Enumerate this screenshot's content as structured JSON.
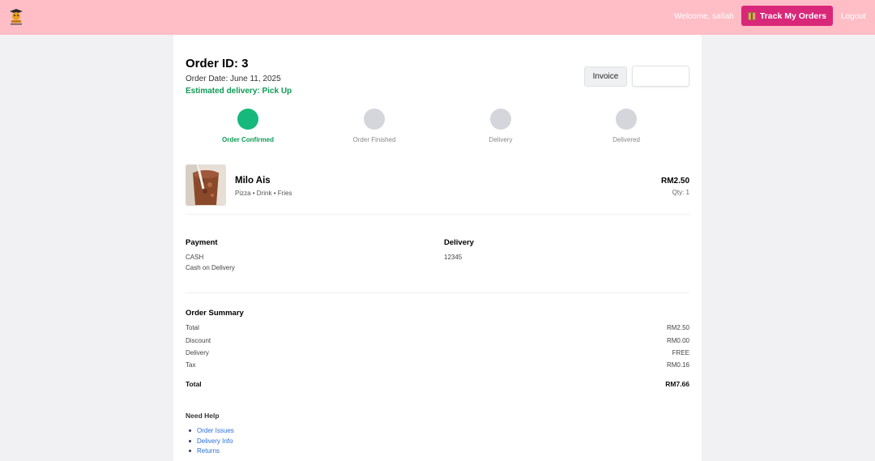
{
  "header": {
    "welcome": "Welcome, safiah",
    "track_label": "Track My Orders",
    "logout_label": "Logout",
    "brand_color": "#ffbdc6",
    "button_color": "#d9277a",
    "track_icon": "box-icon"
  },
  "order": {
    "title": "Order ID: 3",
    "date": "Order Date: June 11, 2025",
    "estimated": "Estimated delivery: Pick Up",
    "invoice_label": "Invoice"
  },
  "progress": {
    "steps": [
      {
        "label": "Order Confirmed",
        "active": true
      },
      {
        "label": "Order Finished",
        "active": false
      },
      {
        "label": "Delivery",
        "active": false
      },
      {
        "label": "Delivered",
        "active": false
      }
    ],
    "active_color": "#17b97a",
    "inactive_color": "#d4d6db"
  },
  "item": {
    "name": "Milo Ais",
    "tags": "Pizza • Drink • Fries",
    "price": "RM2.50",
    "qty": "Qty: 1"
  },
  "payment": {
    "heading": "Payment",
    "method": "CASH",
    "detail": "Cash on Delivery"
  },
  "delivery": {
    "heading": "Delivery",
    "value": "12345"
  },
  "summary": {
    "heading": "Order Summary",
    "rows": [
      {
        "label": "Total",
        "value": "RM2.50"
      },
      {
        "label": "Discount",
        "value": "RM0.00"
      },
      {
        "label": "Delivery",
        "value": "FREE"
      },
      {
        "label": "Tax",
        "value": "RM0.16"
      }
    ],
    "total_label": "Total",
    "total_value": "RM7.66"
  },
  "help": {
    "heading": "Need Help",
    "links": [
      "Order Issues",
      "Delivery Info",
      "Returns"
    ]
  }
}
